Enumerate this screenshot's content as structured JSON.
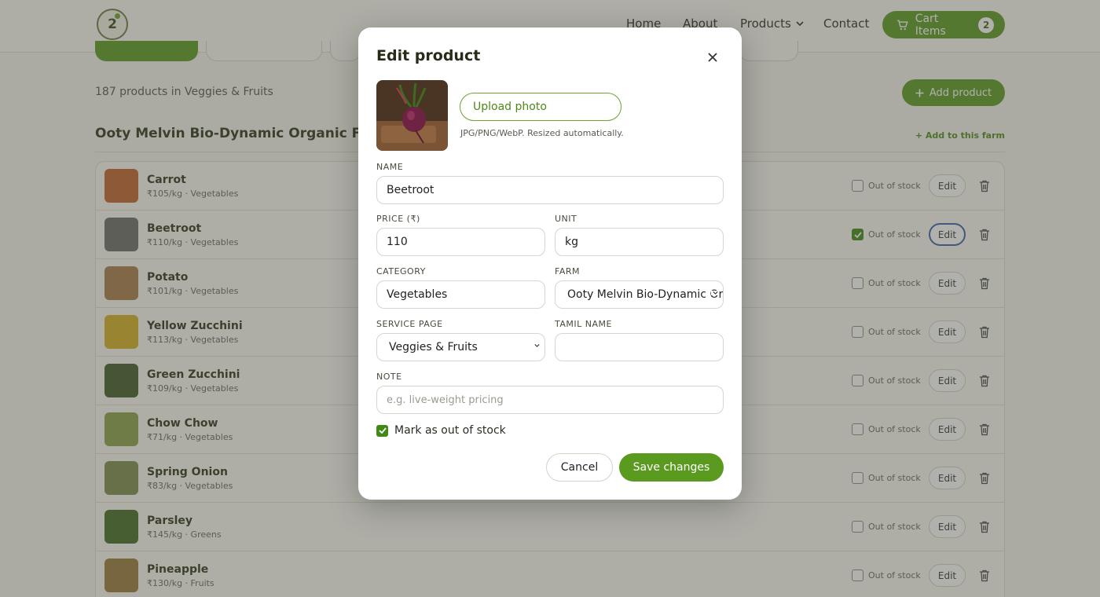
{
  "header": {
    "logo_text": "2",
    "nav": {
      "home": "Home",
      "about": "About",
      "products": "Products",
      "contact": "Contact"
    },
    "cart": {
      "label": "Cart Items",
      "count": "2"
    }
  },
  "page": {
    "count_text": "187 products in Veggies & Fruits",
    "add_product_label": "Add product",
    "farm_heading": "Ooty Melvin Bio-Dynamic Organic Farm · O",
    "add_to_farm_label": "+ Add to this farm"
  },
  "products": [
    {
      "name": "Carrot",
      "meta": "₹105/kg · Vegetables",
      "out_of_stock": false,
      "thumb_color": "#c0622a"
    },
    {
      "name": "Beetroot",
      "meta": "₹110/kg · Vegetables",
      "out_of_stock": true,
      "thumb_color": "#6a6a66"
    },
    {
      "name": "Potato",
      "meta": "₹101/kg · Vegetables",
      "out_of_stock": false,
      "thumb_color": "#a87a48"
    },
    {
      "name": "Yellow Zucchini",
      "meta": "₹113/kg · Vegetables",
      "out_of_stock": false,
      "thumb_color": "#d4b020"
    },
    {
      "name": "Green Zucchini",
      "meta": "₹109/kg · Vegetables",
      "out_of_stock": false,
      "thumb_color": "#3f5a24"
    },
    {
      "name": "Chow Chow",
      "meta": "₹71/kg · Vegetables",
      "out_of_stock": false,
      "thumb_color": "#8aa04a"
    },
    {
      "name": "Spring Onion",
      "meta": "₹83/kg · Vegetables",
      "out_of_stock": false,
      "thumb_color": "#7a8a4a"
    },
    {
      "name": "Parsley",
      "meta": "₹145/kg · Greens",
      "out_of_stock": false,
      "thumb_color": "#3e6a22"
    },
    {
      "name": "Pineapple",
      "meta": "₹130/kg · Fruits",
      "out_of_stock": false,
      "thumb_color": "#9a7838"
    }
  ],
  "row_labels": {
    "out_of_stock": "Out of stock",
    "edit": "Edit"
  },
  "modal": {
    "title": "Edit product",
    "upload_label": "Upload photo",
    "upload_hint": "JPG/PNG/WebP. Resized automatically.",
    "labels": {
      "name": "NAME",
      "price": "PRICE (₹)",
      "unit": "UNIT",
      "category": "CATEGORY",
      "farm": "FARM",
      "service_page": "SERVICE PAGE",
      "tamil_name": "TAMIL NAME",
      "note": "NOTE"
    },
    "values": {
      "name": "Beetroot",
      "price": "110",
      "unit": "kg",
      "category": "Vegetables",
      "farm": "Ooty Melvin Bio-Dynamic Organic Farm",
      "service_page": "Veggies & Fruits",
      "tamil_name": "",
      "note": ""
    },
    "note_placeholder": "e.g. live-weight pricing",
    "mark_out_of_stock_label": "Mark as out of stock",
    "mark_out_of_stock_checked": true,
    "cancel_label": "Cancel",
    "save_label": "Save changes"
  },
  "colors": {
    "accent_green": "#5a9a1e",
    "focus_blue": "#3b5ea8"
  }
}
